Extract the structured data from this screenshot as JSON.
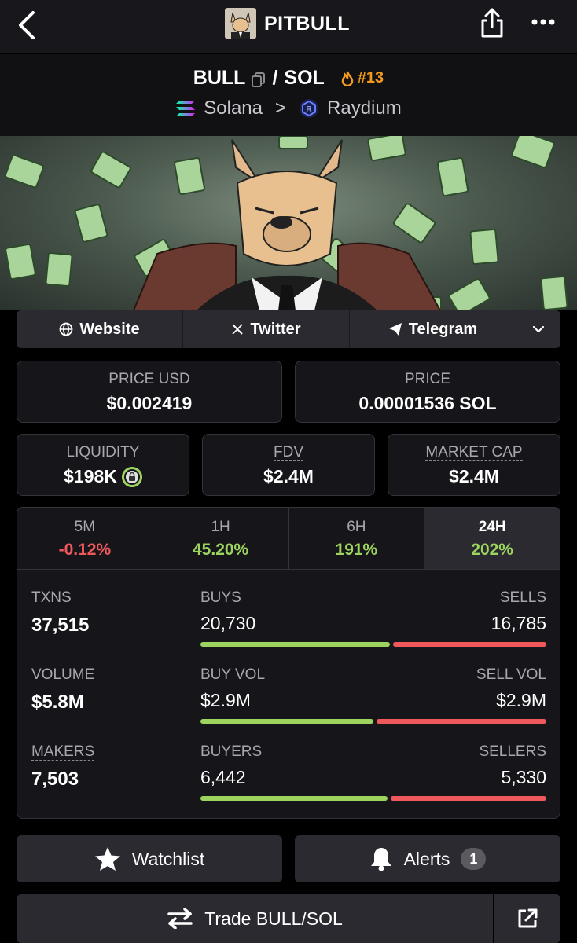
{
  "header": {
    "title": "PITBULL"
  },
  "pair": {
    "base": "BULL",
    "separator": "/",
    "quote": "SOL",
    "rank": "#13",
    "chain": "Solana",
    "chevron": ">",
    "dex": "Raydium"
  },
  "socials": [
    {
      "label": "Website",
      "icon": "globe-icon"
    },
    {
      "label": "Twitter",
      "icon": "x-icon"
    },
    {
      "label": "Telegram",
      "icon": "telegram-icon"
    }
  ],
  "price": {
    "usd_label": "PRICE USD",
    "usd_value": "$0.002419",
    "native_label": "PRICE",
    "native_value": "0.00001536 SOL"
  },
  "metrics": {
    "liquidity_label": "LIQUIDITY",
    "liquidity_value": "$198K",
    "fdv_label": "FDV",
    "fdv_value": "$2.4M",
    "mcap_label": "MARKET CAP",
    "mcap_value": "$2.4M"
  },
  "timeframes": [
    {
      "label": "5M",
      "value": "-0.12%"
    },
    {
      "label": "1H",
      "value": "45.20%"
    },
    {
      "label": "6H",
      "value": "191%"
    },
    {
      "label": "24H",
      "value": "202%"
    }
  ],
  "stats": {
    "txns_label": "TXNS",
    "txns_value": "37,515",
    "volume_label": "VOLUME",
    "volume_value": "$5.8M",
    "makers_label": "MAKERS",
    "makers_value": "7,503",
    "buys_label": "BUYS",
    "buys_value": "20,730",
    "sells_label": "SELLS",
    "sells_value": "16,785",
    "buys_ratio": 0.553,
    "buyvol_label": "BUY VOL",
    "buyvol_value": "$2.9M",
    "sellvol_label": "SELL VOL",
    "sellvol_value": "$2.9M",
    "buyvol_ratio": 0.505,
    "buyers_label": "BUYERS",
    "buyers_value": "6,442",
    "sellers_label": "SELLERS",
    "sellers_value": "5,330",
    "buyers_ratio": 0.547
  },
  "actions": {
    "watchlist_label": "Watchlist",
    "alerts_label": "Alerts",
    "alerts_count": "1",
    "trade_label": "Trade BULL/SOL"
  },
  "colors": {
    "positive": "#9dd45f",
    "negative": "#f0595c",
    "rank": "#f39a1e"
  }
}
